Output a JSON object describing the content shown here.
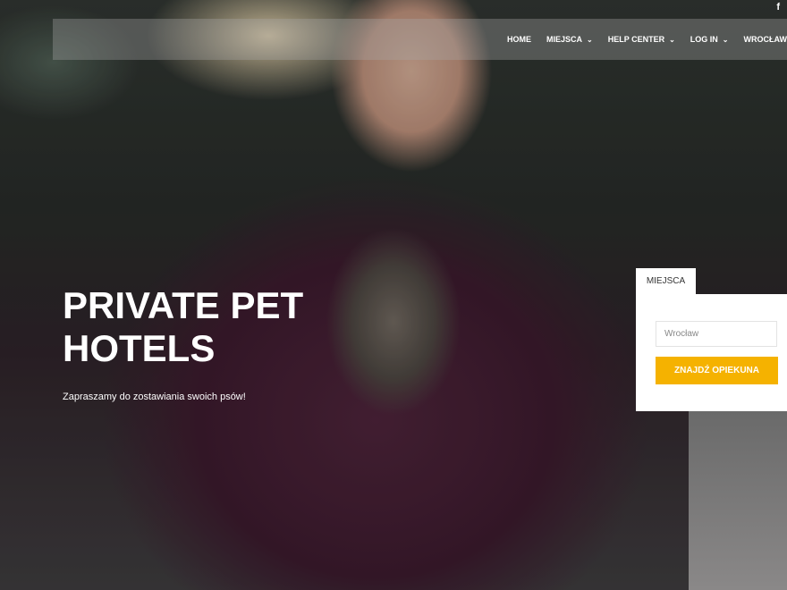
{
  "social": {
    "facebook_icon": "f"
  },
  "nav": {
    "items": [
      {
        "label": "HOME",
        "dropdown": false
      },
      {
        "label": "MIEJSCA",
        "dropdown": true
      },
      {
        "label": "HELP CENTER",
        "dropdown": true
      },
      {
        "label": "LOG IN",
        "dropdown": true
      },
      {
        "label": "WROCŁAW",
        "dropdown": false
      }
    ],
    "chevron": "⌄"
  },
  "hero": {
    "title": "PRIVATE PET HOTELS",
    "subtitle": "Zapraszamy do zostawiania swoich psów!"
  },
  "search": {
    "tab_label": "MIEJSCA",
    "input_value": "Wrocław",
    "button_label": "ZNAJDŹ OPIEKUNA"
  },
  "colors": {
    "accent": "#f5b200",
    "panel": "#ffffff"
  }
}
